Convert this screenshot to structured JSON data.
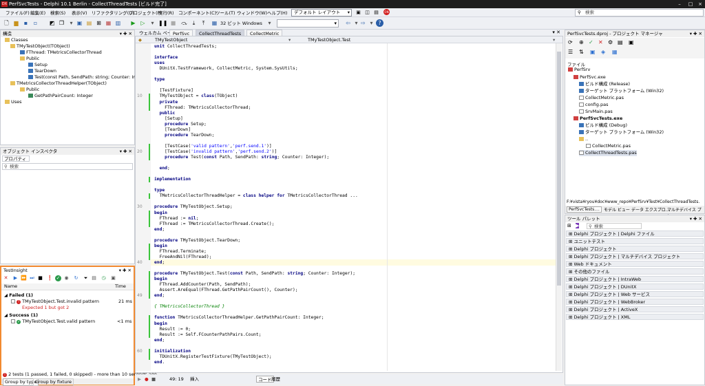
{
  "title": {
    "app_title": "PerfSvcTests - Delphi 10.1 Berlin - CollectThreadTests [ビルド完了]",
    "logo": "DX"
  },
  "menu": [
    "ファイル(F)",
    "編集(E)",
    "検索(S)",
    "表示(V)",
    "リファクタリング(O)",
    "プロジェクト(P)",
    "実行(R)",
    "コンポーネント(C)",
    "ツール(T)",
    "ウィンドウ(W)",
    "ヘルプ(H)"
  ],
  "layout_select": "デフォルト レイアウト",
  "search_placeholder": "検索",
  "toolbar": {
    "platform": "32 ビット Windows"
  },
  "structure": {
    "title": "構造",
    "items": [
      "Classes",
      "TMyTestObject(TObject)",
      "FThread: TMetricsCollectorThread",
      "Public",
      "Setup",
      "TearDown",
      "Test(const Path, SendPath: string; Counter: In",
      "TMetricsCollectorThreadHelper(TObject)",
      "Public",
      "GetPathPairCount: Integer",
      "Uses"
    ]
  },
  "inspector": {
    "title": "オブジェクト インスペクタ",
    "tab": "プロパティ",
    "search": "検索"
  },
  "editor": {
    "tabs": [
      "ウェルカム ページ",
      "PerfSvc",
      "CollectThreadTests",
      "CollectMetric"
    ],
    "combo_left": "TMyTestObject",
    "combo_right": "TMyTestObject.Test",
    "lines": [
      "unit CollectThreadTests;",
      "",
      "interface",
      "uses",
      "  DUnitX.TestFramework, CollectMetric, System.SysUtils;",
      "",
      "type",
      "",
      "  [TestFixture]",
      "  TMyTestObject = class(TObject)",
      "  private",
      "    FThread: TMetricsCollectorThread;",
      "  public",
      "    [Setup]",
      "    procedure Setup;",
      "    [TearDown]",
      "    procedure TearDown;",
      "",
      "    [TestCase('valid pattern','perf.send.1')]",
      "    [TestCase('invalid pattern','perf.send.2')]",
      "    procedure Test(const Path, SendPath: string; Counter: Integer);",
      "",
      "  end;",
      "",
      "implementation",
      "",
      "type",
      "  TMetricsCollectorThreadHelper = class helper for TMetricsCollectorThread ...",
      "",
      "procedure TMyTestObject.Setup;",
      "begin",
      "  FThread := nil;",
      "  FThread := TMetricsCollectorThread.Create();",
      "end;",
      "",
      "procedure TMyTestObject.TearDown;",
      "begin",
      "  FThread.Terminate;",
      "  FreeAndNil(FThread);",
      "end;",
      "",
      "procedure TMyTestObject.Test(const Path, SendPath: string; Counter: Integer);",
      "begin",
      "  FThread.AddCounter(Path, SendPath);",
      "  Assert.AreEqual(FThread.GetPathPairCount(), Counter);",
      "end;",
      "",
      "{ TMetricsCollectorThread }",
      "",
      "function TMetricsCollectorThreadHelper.GetPathPairCount: Integer;",
      "begin",
      "  Result := 0;",
      "  Result := Self.FCounterPathPairs.Count;",
      "end;",
      "",
      "initialization",
      "  TDUnitX.RegisterTestFixture(TMyTestObject);",
      "end."
    ],
    "line_numbers": [
      "10",
      "20",
      "30",
      "40",
      "49",
      "60"
    ],
    "status_pos": "49: 19",
    "status_mode": "挿入",
    "status_tabs": [
      "コード",
      "履歴"
    ]
  },
  "project": {
    "title": "PerfSvcTests.dproj - プロジェクト マネージャ",
    "file_label": "ファイル",
    "items": [
      "PerfSrv",
      "PerfSvc.exe",
      "ビルド構成 (Release)",
      "ターゲット プラットフォーム (Win32)",
      "CollectMetric.pas",
      "config.pas",
      "SrvMain.pas",
      "PerfSvcTests.exe",
      "ビルド構成 (Debug)",
      "ターゲット プラットフォーム (Win32)",
      "..",
      "CollectMetric.pas",
      "CollectThreadTests.pas"
    ],
    "path": "F:¥vista¥ryou¥doc¥www_repo¥PerfSrv¥Test¥CollectThreadTests.",
    "tabs": [
      "PerfSvcTests....",
      "モデル ビュー",
      "データ エクスプロ...",
      "マルチデバイス プレ..."
    ]
  },
  "palette": {
    "title": "ツール パレット",
    "search": "検索",
    "items": [
      "Delphi プロジェクト | Delphi ファイル",
      "ユニットテスト",
      "Delphi プロジェクト",
      "Delphi プロジェクト | マルチデバイス プロジェクト",
      "Web ドキュメント",
      "その他のファイル",
      "Delphi プロジェクト | IntraWeb",
      "Delphi プロジェクト | DUnitX",
      "Delphi プロジェクト | Web サービス",
      "Delphi プロジェクト | WebBroker",
      "Delphi プロジェクト | ActiveX",
      "Delphi プロジェクト | XML"
    ]
  },
  "testinsight": {
    "title": "TestInsight",
    "col_name": "Name",
    "col_time": "Time",
    "failed_group": "Failed (1)",
    "failed_test": "TMyTestObject.Test.invalid pattern",
    "failed_time": "21 ms",
    "failed_msg": "Expected 1 but got 2",
    "success_group": "Success (1)",
    "success_test": "TMyTestObject.Test.valid pattern",
    "success_time": "<1 ms",
    "summary": "2 tests (1 passed, 1 failed, 0 skipped) - more than 10 seconds ago",
    "tabs": [
      "Group by type",
      "Group by fixture"
    ]
  },
  "colors": {
    "accent": "#f28a30",
    "keyword": "#000080",
    "string": "#0000ff",
    "comment": "#008000",
    "modified": "#3bc53b"
  }
}
